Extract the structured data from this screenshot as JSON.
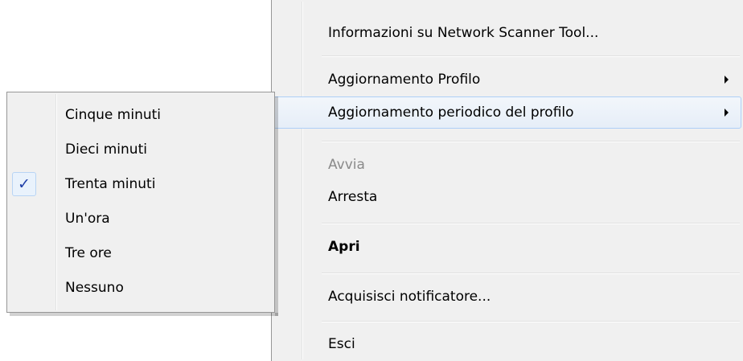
{
  "main_menu": {
    "items": [
      {
        "label": "Informazioni su Network Scanner Tool..."
      },
      {
        "label": "Aggiornamento Profilo"
      },
      {
        "label": "Aggiornamento periodico del profilo"
      },
      {
        "label": "Avvia"
      },
      {
        "label": "Arresta"
      },
      {
        "label": "Apri"
      },
      {
        "label": "Acquisisci notificatore..."
      },
      {
        "label": "Esci"
      }
    ]
  },
  "submenu": {
    "items": [
      {
        "label": "Cinque minuti"
      },
      {
        "label": "Dieci minuti"
      },
      {
        "label": "Trenta minuti"
      },
      {
        "label": "Un'ora"
      },
      {
        "label": "Tre ore"
      },
      {
        "label": "Nessuno"
      }
    ],
    "checked_item": "Trenta minuti",
    "check_glyph": "✓"
  },
  "colors": {
    "menu_background": "#f0f0f0",
    "highlight_border": "#aecff7",
    "check_color": "#1f3fa8",
    "disabled_text": "#8a8a8a"
  }
}
